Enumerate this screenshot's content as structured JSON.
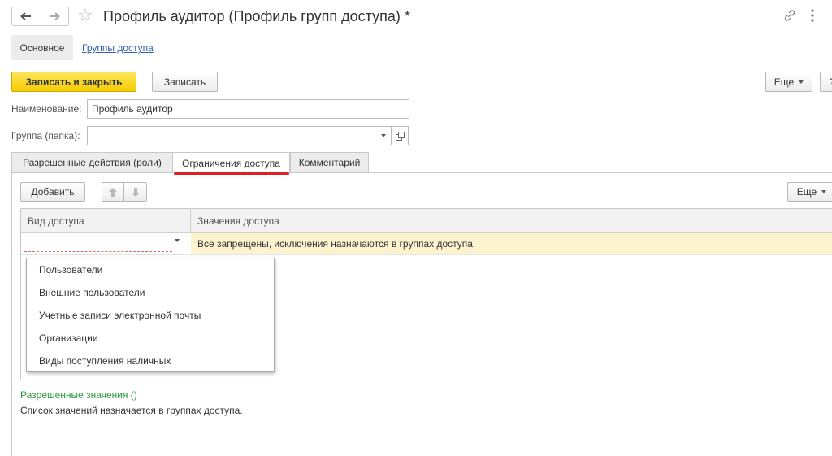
{
  "window": {
    "title": "Профиль аудитор (Профиль групп доступа) *"
  },
  "icons": {
    "back": "arrow-left-icon",
    "forward": "arrow-right-icon",
    "favorite": "star-icon",
    "link": "link-icon",
    "more": "vertical-dots-icon",
    "up": "arrow-up-icon",
    "down": "arrow-down-icon",
    "open": "open-form-icon"
  },
  "sections": {
    "main": "Основное",
    "groups": "Группы доступа"
  },
  "toolbar": {
    "save_close": "Записать и закрыть",
    "save": "Записать",
    "more": "Еще",
    "help": "?"
  },
  "form": {
    "name_label": "Наименование:",
    "name_value": "Профиль аудитор",
    "group_label": "Группа (папка):",
    "group_value": ""
  },
  "tabs": [
    {
      "label": "Разрешенные действия (роли)",
      "active": false
    },
    {
      "label": "Ограничения доступа",
      "active": true
    },
    {
      "label": "Комментарий",
      "active": false
    }
  ],
  "table_toolbar": {
    "add": "Добавить",
    "more": "Еще"
  },
  "table": {
    "columns": [
      "Вид доступа",
      "Значения доступа"
    ],
    "row": {
      "kind": "",
      "values": "Все запрещены, исключения назначаются в группах доступа"
    }
  },
  "dropdown_items": [
    "Пользователи",
    "Внешние пользователи",
    "Учетные записи электронной почты",
    "Организации",
    "Виды поступления наличных"
  ],
  "allowed": {
    "title": "Разрешенные значения ()",
    "description": "Список значений назначается в группах доступа."
  },
  "colors": {
    "primary_button": "#f5cc00",
    "active_tab_underline": "#e02020",
    "row_highlight": "#fdf4cf",
    "green_label": "#2e9a3c",
    "link": "#3060b0"
  }
}
